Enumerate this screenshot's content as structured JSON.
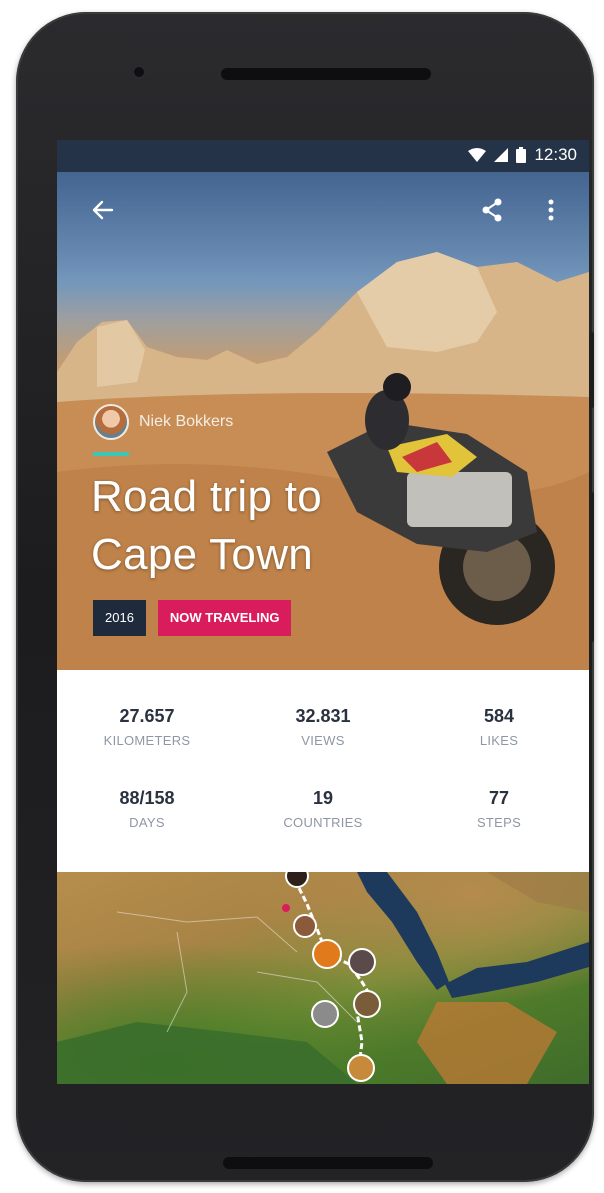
{
  "status_bar": {
    "time": "12:30"
  },
  "hero": {
    "author_name": "Niek Bokkers",
    "title": "Road trip to Cape Town",
    "year_badge": "2016",
    "status_badge": "NOW TRAVELING"
  },
  "stats": [
    {
      "value": "27.657",
      "label": "KILOMETERS"
    },
    {
      "value": "32.831",
      "label": "VIEWS"
    },
    {
      "value": "584",
      "label": "LIKES"
    },
    {
      "value": "88/158",
      "label": "DAYS"
    },
    {
      "value": "19",
      "label": "COUNTRIES"
    },
    {
      "value": "77",
      "label": "STEPS"
    }
  ],
  "colors": {
    "status_bar": "#243348",
    "accent": "#3cc6b6",
    "year_badge": "#1f2b3c",
    "live_badge": "#d91d5c"
  },
  "icons": {
    "back": "arrow-left-icon",
    "share": "share-icon",
    "more": "more-vert-icon",
    "wifi": "wifi-icon",
    "signal": "signal-icon",
    "battery": "battery-icon"
  }
}
